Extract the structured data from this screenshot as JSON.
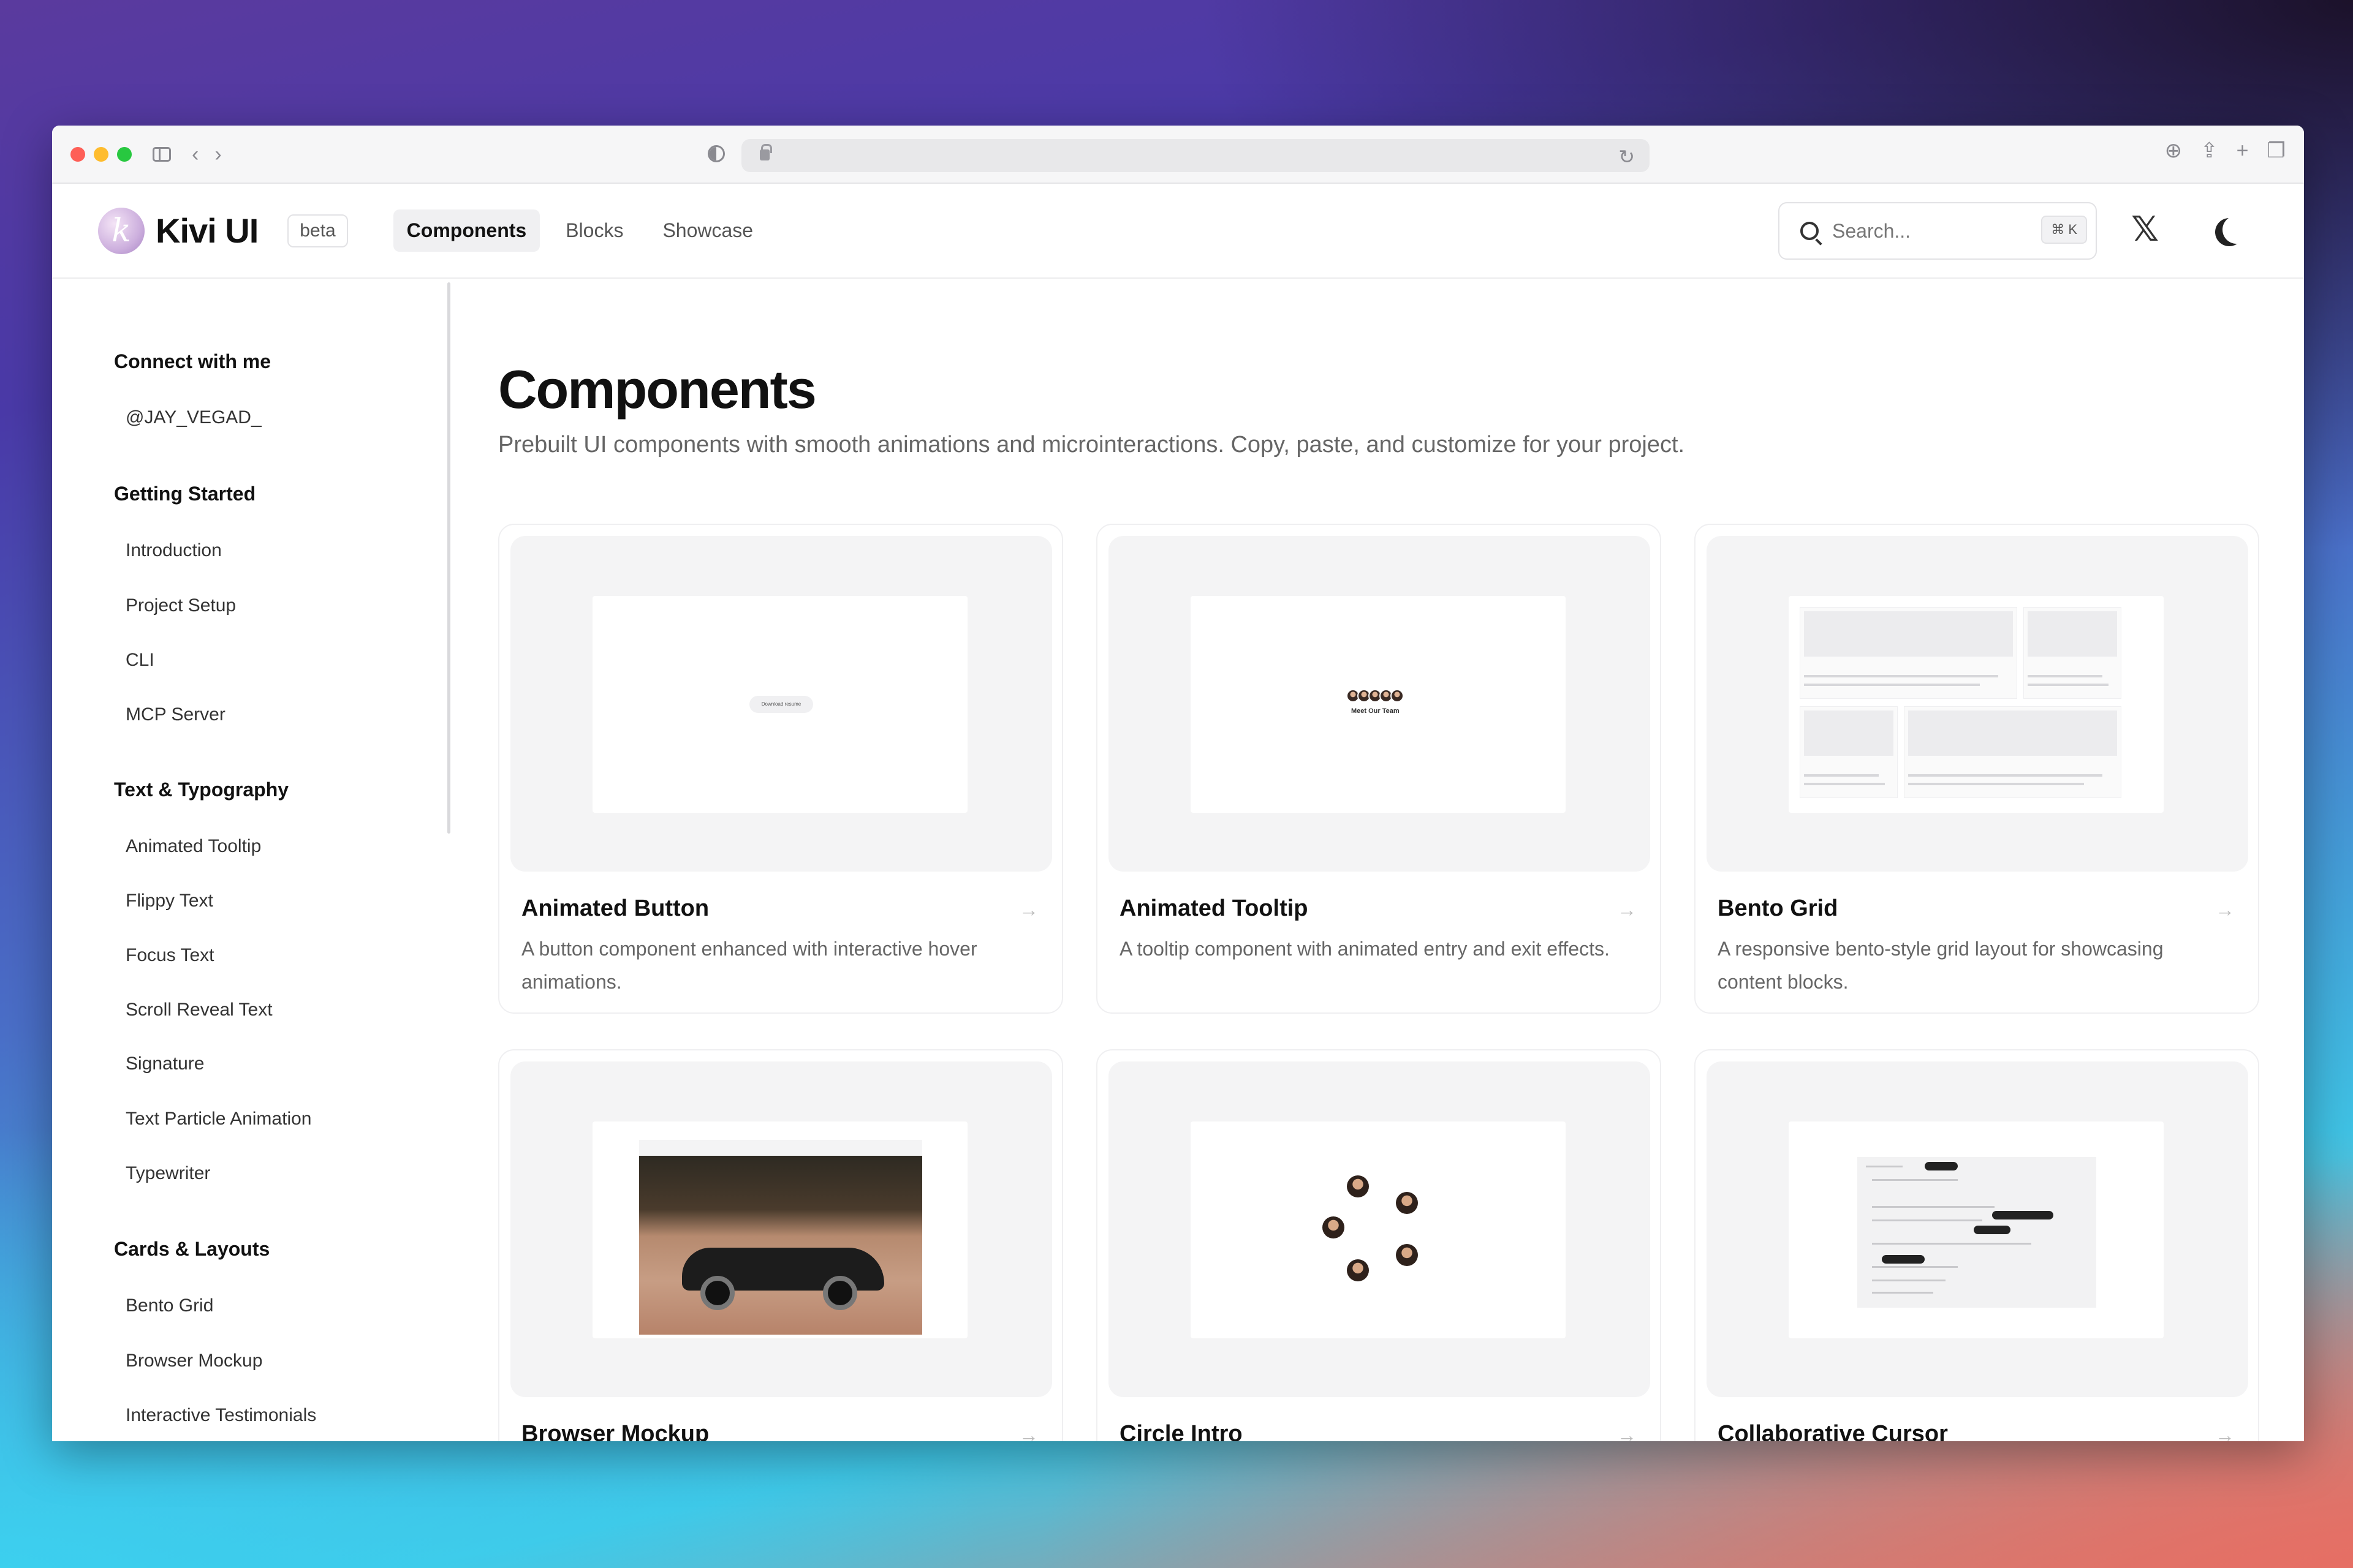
{
  "browser": {
    "url": ""
  },
  "header": {
    "logo_letter": "k",
    "logo_text": "Kivi UI",
    "badge": "beta",
    "nav": [
      {
        "label": "Components"
      },
      {
        "label": "Blocks"
      },
      {
        "label": "Showcase"
      }
    ],
    "search_placeholder": "Search...",
    "search_shortcut": "⌘ K",
    "x_icon": "𝕏"
  },
  "sidebar": {
    "groups": [
      {
        "title": "Connect with me",
        "items": [
          "@JAY_VEGAD_"
        ]
      },
      {
        "title": "Getting Started",
        "items": [
          "Introduction",
          "Project Setup",
          "CLI",
          "MCP Server"
        ]
      },
      {
        "title": "Text & Typography",
        "items": [
          "Animated Tooltip",
          "Flippy Text",
          "Focus Text",
          "Scroll Reveal Text",
          "Signature",
          "Text Particle Animation",
          "Typewriter"
        ]
      },
      {
        "title": "Cards & Layouts",
        "items": [
          "Bento Grid",
          "Browser Mockup",
          "Interactive Testimonials"
        ]
      }
    ]
  },
  "main": {
    "title": "Components",
    "subtitle": "Prebuilt UI components with smooth animations and microinteractions. Copy, paste, and customize for your project.",
    "cards": [
      {
        "title": "Animated Button",
        "desc": "A button component enhanced with interactive hover animations.",
        "preview_text": "Download resume"
      },
      {
        "title": "Animated Tooltip",
        "desc": "A tooltip component with animated entry and exit effects.",
        "preview_text": "Meet Our Team"
      },
      {
        "title": "Bento Grid",
        "desc": "A responsive bento-style grid layout for showcasing content blocks."
      },
      {
        "title": "Browser Mockup",
        "desc": ""
      },
      {
        "title": "Circle Intro",
        "desc": ""
      },
      {
        "title": "Collaborative Cursor",
        "desc": ""
      }
    ],
    "arrow": "→"
  },
  "colors": {
    "accent": "#111111",
    "muted": "#666666",
    "traffic_red": "#fe5f57",
    "traffic_yellow": "#febc2e",
    "traffic_green": "#28c840"
  }
}
